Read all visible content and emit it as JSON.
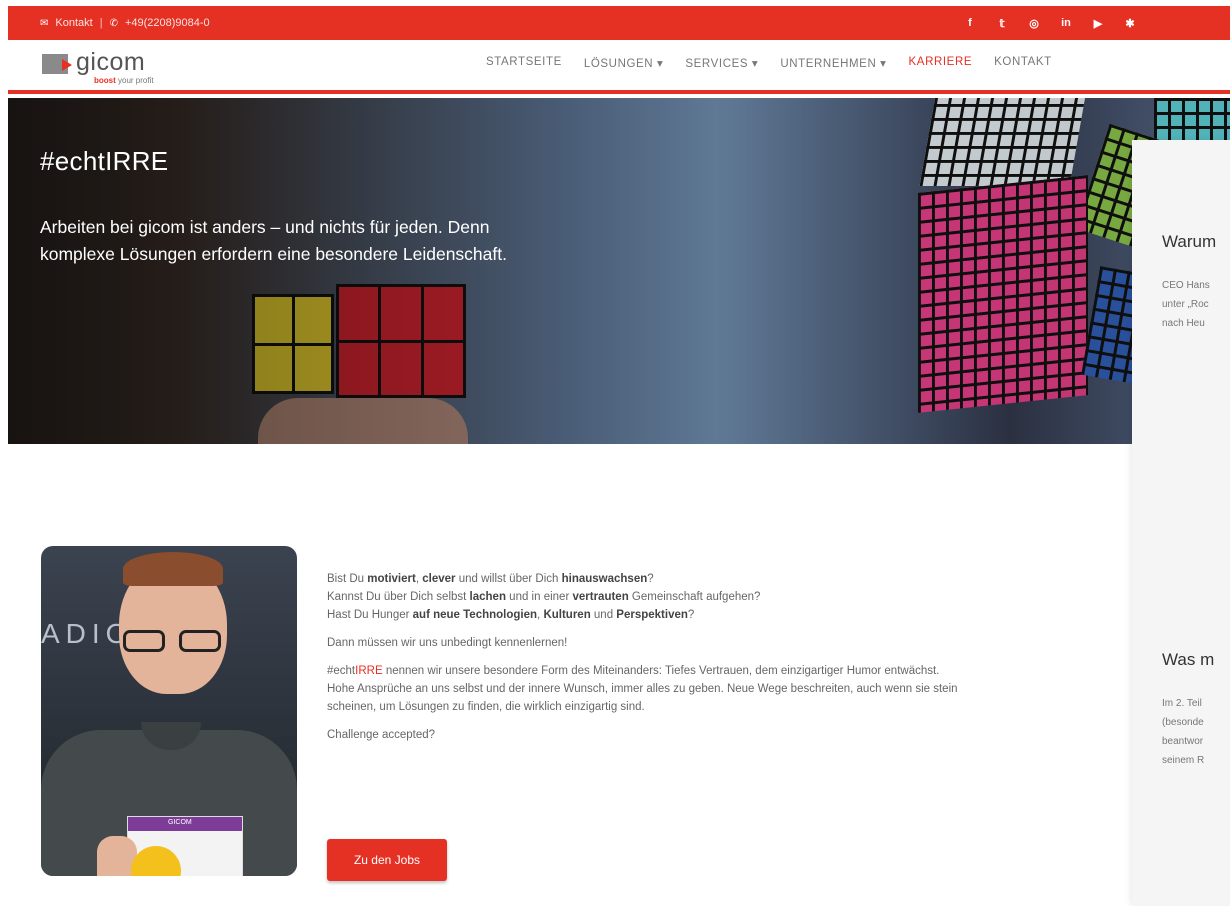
{
  "topbar": {
    "contact_label": "Kontakt",
    "phone": "+49(2208)9084-0",
    "social": [
      "f",
      "t",
      "ig",
      "in",
      "yt",
      "uk"
    ]
  },
  "header": {
    "logo_word": "gicom",
    "logo_tag_strong": "boost",
    "logo_tag_rest": " your profit",
    "nav": [
      "STARTSEITE",
      "LÖSUNGEN ▾",
      "SERVICES ▾",
      "UNTERNEHMEN ▾",
      "KARRIERE",
      "KONTAKT"
    ],
    "active_nav": "KARRIERE"
  },
  "hero": {
    "title": "#echtIRRE",
    "text_line1": "Arbeiten bei gicom ist anders – und nichts für jeden. Denn",
    "text_line2": "komplexe Lösungen erfordern eine besondere Leidenschaft."
  },
  "portrait": {
    "sign_text": "ADIO",
    "card_label": "GICOM"
  },
  "content": {
    "q1_a": "Bist Du ",
    "q1_b": "motiviert",
    "q1_c": ", ",
    "q1_d": "clever",
    "q1_e": " und willst über Dich ",
    "q1_f": "hinauswachsen",
    "q1_g": "?",
    "q2_a": "Kannst Du über Dich selbst ",
    "q2_b": "lachen",
    "q2_c": " und in einer ",
    "q2_d": "vertrauten",
    "q2_e": " Gemeinschaft aufgehen?",
    "q3_a": "Hast Du Hunger ",
    "q3_b": "auf neue Technologien",
    "q3_c": ", ",
    "q3_d": "Kulturen",
    "q3_e": " und ",
    "q3_f": "Perspektiven",
    "q3_g": "?",
    "meet": "Dann müssen wir uns unbedingt kennenlernen!",
    "echt_prefix": "#echt",
    "echt_red": "IRRE",
    "echt_rest": " nennen wir unsere besondere Form des Miteinanders: Tiefes Vertrauen, dem einzigartiger Humor entwächst.",
    "line2": "Hohe Ansprüche an uns selbst und der innere Wunsch, immer alles zu geben. Neue Wege beschreiten, auch wenn sie stein",
    "line3": "scheinen, um Lösungen zu finden, die wirklich einzigartig sind.",
    "challenge": "Challenge accepted?",
    "button": "Zu den Jobs"
  },
  "side_panel": {
    "title1": "Warum",
    "text1": [
      "CEO Hans",
      "unter „Roc",
      "nach Heu"
    ],
    "title2": "Was m",
    "text2": [
      "Im 2. Teil",
      "(besonde",
      "beantwor",
      "seinem R"
    ]
  },
  "colors": {
    "accent": "#e53024"
  }
}
